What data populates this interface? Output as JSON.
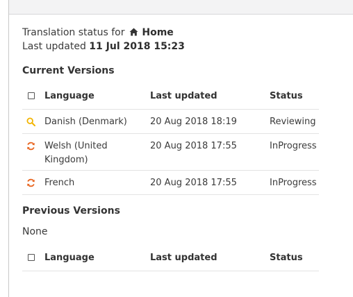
{
  "header": {
    "translation_status_prefix": "Translation status for",
    "page_name": "Home",
    "last_updated_prefix": "Last updated",
    "last_updated_value": "11 Jul 2018 15:23"
  },
  "current_versions": {
    "title": "Current Versions",
    "columns": {
      "language": "Language",
      "last_updated": "Last updated",
      "status": "Status"
    },
    "rows": [
      {
        "icon": "magnifier-icon",
        "icon_color": "#f2b400",
        "language": "Danish (Denmark)",
        "last_updated": "20 Aug 2018 18:19",
        "status": "Reviewing"
      },
      {
        "icon": "refresh-icon",
        "icon_color": "#e8641e",
        "language": "Welsh (United Kingdom)",
        "last_updated": "20 Aug 2018 17:55",
        "status": "InProgress"
      },
      {
        "icon": "refresh-icon",
        "icon_color": "#e8641e",
        "language": "French",
        "last_updated": "20 Aug 2018 17:55",
        "status": "InProgress"
      }
    ]
  },
  "previous_versions": {
    "title": "Previous Versions",
    "empty_text": "None",
    "columns": {
      "language": "Language",
      "last_updated": "Last updated",
      "status": "Status"
    }
  }
}
